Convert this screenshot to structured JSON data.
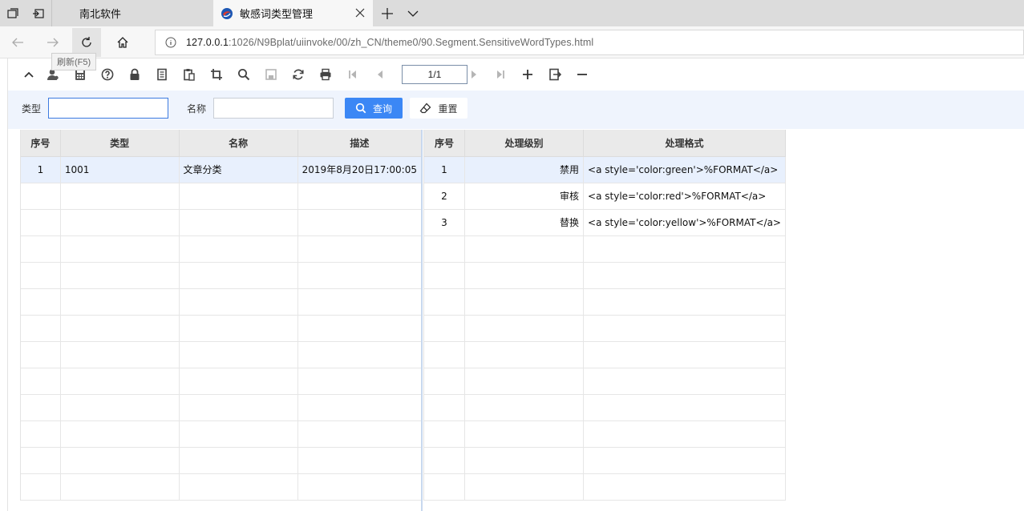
{
  "browser": {
    "tabs": [
      {
        "title": "南北软件",
        "active": false
      },
      {
        "title": "敏感词类型管理",
        "active": true
      }
    ],
    "url_host": "127.0.0.1",
    "url_rest": ":1026/N9Bplat/uiinvoke/00/zh_CN/theme0/90.Segment.SensitiveWordTypes.html",
    "tooltip": "刷新(F5)"
  },
  "toolbar": {
    "icons": [
      "chevron-up-icon",
      "user-icon",
      "calculator-icon",
      "help-icon",
      "lock-icon",
      "document-icon",
      "paste-icon",
      "crop-icon",
      "search-icon",
      "save-icon",
      "refresh-icon",
      "print-icon",
      "first-page-icon",
      "prev-page-icon",
      "next-page-icon",
      "last-page-icon",
      "add-icon",
      "export-icon",
      "minus-icon"
    ],
    "pager": "1/1"
  },
  "query": {
    "type_label": "类型",
    "name_label": "名称",
    "type_value": "",
    "name_value": "",
    "search_label": "查询",
    "reset_label": "重置"
  },
  "left_grid": {
    "columns": [
      "序号",
      "类型",
      "名称",
      "描述"
    ],
    "rows": [
      {
        "no": "1",
        "type": "1001",
        "name": "文章分类",
        "desc": "2019年8月20日17:00:05"
      }
    ]
  },
  "right_grid": {
    "columns": [
      "序号",
      "处理级别",
      "处理格式"
    ],
    "rows": [
      {
        "no": "1",
        "level": "禁用",
        "format": "<a style='color:green'>%FORMAT</a>"
      },
      {
        "no": "2",
        "level": "审核",
        "format": "<a style='color:red'>%FORMAT</a>"
      },
      {
        "no": "3",
        "level": "替换",
        "format": "<a style='color:yellow'>%FORMAT</a>"
      }
    ]
  },
  "colors": {
    "accent": "#3b87f5",
    "selected_row": "#e8f0fd",
    "query_bg": "#eff4fd"
  }
}
